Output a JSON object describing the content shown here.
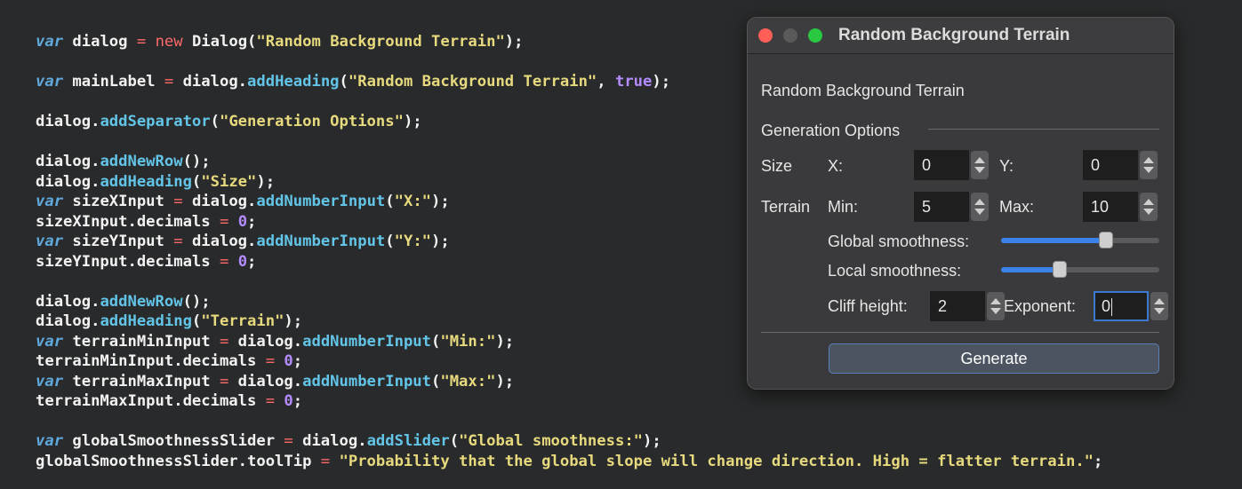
{
  "code_lines": [
    [
      {
        "t": "var",
        "c": "kw"
      },
      {
        "t": " dialog ",
        "c": "id"
      },
      {
        "t": "=",
        "c": "op"
      },
      {
        "t": " ",
        "c": "id"
      },
      {
        "t": "new",
        "c": "new"
      },
      {
        "t": " Dialog(",
        "c": "id"
      },
      {
        "t": "\"Random Background Terrain\"",
        "c": "str"
      },
      {
        "t": ");",
        "c": "p"
      }
    ],
    [],
    [
      {
        "t": "var",
        "c": "kw"
      },
      {
        "t": " mainLabel ",
        "c": "id"
      },
      {
        "t": "=",
        "c": "op"
      },
      {
        "t": " dialog.",
        "c": "id"
      },
      {
        "t": "addHeading",
        "c": "fn"
      },
      {
        "t": "(",
        "c": "p"
      },
      {
        "t": "\"Random Background Terrain\"",
        "c": "str"
      },
      {
        "t": ", ",
        "c": "p"
      },
      {
        "t": "true",
        "c": "num"
      },
      {
        "t": ");",
        "c": "p"
      }
    ],
    [],
    [
      {
        "t": "dialog.",
        "c": "id"
      },
      {
        "t": "addSeparator",
        "c": "fn"
      },
      {
        "t": "(",
        "c": "p"
      },
      {
        "t": "\"Generation Options\"",
        "c": "str"
      },
      {
        "t": ");",
        "c": "p"
      }
    ],
    [],
    [
      {
        "t": "dialog.",
        "c": "id"
      },
      {
        "t": "addNewRow",
        "c": "fn"
      },
      {
        "t": "();",
        "c": "p"
      }
    ],
    [
      {
        "t": "dialog.",
        "c": "id"
      },
      {
        "t": "addHeading",
        "c": "fn"
      },
      {
        "t": "(",
        "c": "p"
      },
      {
        "t": "\"Size\"",
        "c": "str"
      },
      {
        "t": ");",
        "c": "p"
      }
    ],
    [
      {
        "t": "var",
        "c": "kw"
      },
      {
        "t": " sizeXInput ",
        "c": "id"
      },
      {
        "t": "=",
        "c": "op"
      },
      {
        "t": " dialog.",
        "c": "id"
      },
      {
        "t": "addNumberInput",
        "c": "fn"
      },
      {
        "t": "(",
        "c": "p"
      },
      {
        "t": "\"X:\"",
        "c": "str"
      },
      {
        "t": ");",
        "c": "p"
      }
    ],
    [
      {
        "t": "sizeXInput.decimals ",
        "c": "id"
      },
      {
        "t": "=",
        "c": "op"
      },
      {
        "t": " ",
        "c": "id"
      },
      {
        "t": "0",
        "c": "num"
      },
      {
        "t": ";",
        "c": "p"
      }
    ],
    [
      {
        "t": "var",
        "c": "kw"
      },
      {
        "t": " sizeYInput ",
        "c": "id"
      },
      {
        "t": "=",
        "c": "op"
      },
      {
        "t": " dialog.",
        "c": "id"
      },
      {
        "t": "addNumberInput",
        "c": "fn"
      },
      {
        "t": "(",
        "c": "p"
      },
      {
        "t": "\"Y:\"",
        "c": "str"
      },
      {
        "t": ");",
        "c": "p"
      }
    ],
    [
      {
        "t": "sizeYInput.decimals ",
        "c": "id"
      },
      {
        "t": "=",
        "c": "op"
      },
      {
        "t": " ",
        "c": "id"
      },
      {
        "t": "0",
        "c": "num"
      },
      {
        "t": ";",
        "c": "p"
      }
    ],
    [],
    [
      {
        "t": "dialog.",
        "c": "id"
      },
      {
        "t": "addNewRow",
        "c": "fn"
      },
      {
        "t": "();",
        "c": "p"
      }
    ],
    [
      {
        "t": "dialog.",
        "c": "id"
      },
      {
        "t": "addHeading",
        "c": "fn"
      },
      {
        "t": "(",
        "c": "p"
      },
      {
        "t": "\"Terrain\"",
        "c": "str"
      },
      {
        "t": ");",
        "c": "p"
      }
    ],
    [
      {
        "t": "var",
        "c": "kw"
      },
      {
        "t": " terrainMinInput ",
        "c": "id"
      },
      {
        "t": "=",
        "c": "op"
      },
      {
        "t": " dialog.",
        "c": "id"
      },
      {
        "t": "addNumberInput",
        "c": "fn"
      },
      {
        "t": "(",
        "c": "p"
      },
      {
        "t": "\"Min:\"",
        "c": "str"
      },
      {
        "t": ");",
        "c": "p"
      }
    ],
    [
      {
        "t": "terrainMinInput.decimals ",
        "c": "id"
      },
      {
        "t": "=",
        "c": "op"
      },
      {
        "t": " ",
        "c": "id"
      },
      {
        "t": "0",
        "c": "num"
      },
      {
        "t": ";",
        "c": "p"
      }
    ],
    [
      {
        "t": "var",
        "c": "kw"
      },
      {
        "t": " terrainMaxInput ",
        "c": "id"
      },
      {
        "t": "=",
        "c": "op"
      },
      {
        "t": " dialog.",
        "c": "id"
      },
      {
        "t": "addNumberInput",
        "c": "fn"
      },
      {
        "t": "(",
        "c": "p"
      },
      {
        "t": "\"Max:\"",
        "c": "str"
      },
      {
        "t": ");",
        "c": "p"
      }
    ],
    [
      {
        "t": "terrainMaxInput.decimals ",
        "c": "id"
      },
      {
        "t": "=",
        "c": "op"
      },
      {
        "t": " ",
        "c": "id"
      },
      {
        "t": "0",
        "c": "num"
      },
      {
        "t": ";",
        "c": "p"
      }
    ],
    [],
    [
      {
        "t": "var",
        "c": "kw"
      },
      {
        "t": " globalSmoothnessSlider ",
        "c": "id"
      },
      {
        "t": "=",
        "c": "op"
      },
      {
        "t": " dialog.",
        "c": "id"
      },
      {
        "t": "addSlider",
        "c": "fn"
      },
      {
        "t": "(",
        "c": "p"
      },
      {
        "t": "\"Global smoothness:\"",
        "c": "str"
      },
      {
        "t": ");",
        "c": "p"
      }
    ],
    [
      {
        "t": "globalSmoothnessSlider.toolTip ",
        "c": "id"
      },
      {
        "t": "=",
        "c": "op"
      },
      {
        "t": " ",
        "c": "id"
      },
      {
        "t": "\"Probability that the global slope will change direction. High = flatter terrain.\"",
        "c": "str"
      },
      {
        "t": ";",
        "c": "p"
      }
    ]
  ],
  "dialog": {
    "title": "Random Background Terrain",
    "heading": "Random Background Terrain",
    "separator_label": "Generation Options",
    "size": {
      "heading": "Size",
      "x_label": "X:",
      "x_value": "0",
      "y_label": "Y:",
      "y_value": "0"
    },
    "terrain": {
      "heading": "Terrain",
      "min_label": "Min:",
      "min_value": "5",
      "max_label": "Max:",
      "max_value": "10"
    },
    "global_smoothness": {
      "label": "Global smoothness:",
      "level": 0.68
    },
    "local_smoothness": {
      "label": "Local smoothness:",
      "level": 0.36
    },
    "cliff_height": {
      "label": "Cliff height:",
      "value": "2"
    },
    "exponent": {
      "label": "Exponent:",
      "value": "0"
    },
    "generate_label": "Generate"
  },
  "colors": {
    "close": "#ff5f57",
    "minimize": "#5a5a5a",
    "zoom": "#28c840",
    "accent": "#3b82e8"
  }
}
